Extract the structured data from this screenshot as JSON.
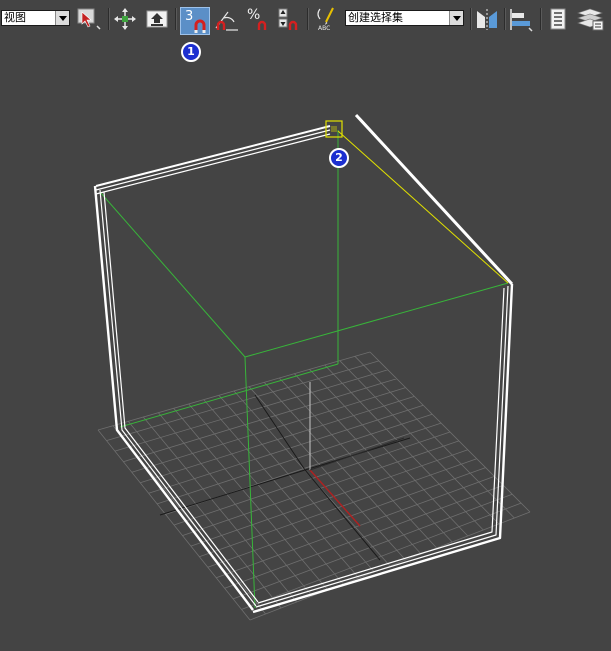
{
  "toolbar": {
    "view_dropdown": "视图",
    "snap_toggle_label": "3",
    "angle_snap_label": "",
    "percent_snap_label": "%",
    "selection_set_dropdown": "创建选择集",
    "abc_label": "ABC"
  },
  "callouts": {
    "one": "1",
    "two": "2"
  },
  "colors": {
    "background": "#444444",
    "highlight_button": "#5b8fc7",
    "callout_fill": "#1c2fd0",
    "wire_white": "#ffffff",
    "wire_green": "#38b53a",
    "wire_yellow": "#e0e000",
    "grid": "#6e6e6e"
  },
  "icons": {
    "view_dropdown": "dropdown-arrow-icon",
    "named_selection": "named-selection-icon",
    "move": "move-cross-icon",
    "upload": "upload-arrow-icon",
    "snap": "magnet-icon",
    "angle_snap": "angle-snap-icon",
    "percent_snap": "percent-snap-icon",
    "spinner_snap": "spinner-snap-icon",
    "edit_named_selection": "edit-named-abc-icon",
    "mirror": "mirror-icon",
    "align": "align-icon",
    "layer_manager": "layer-list-icon",
    "scene_explorer": "layers-stack-icon"
  }
}
